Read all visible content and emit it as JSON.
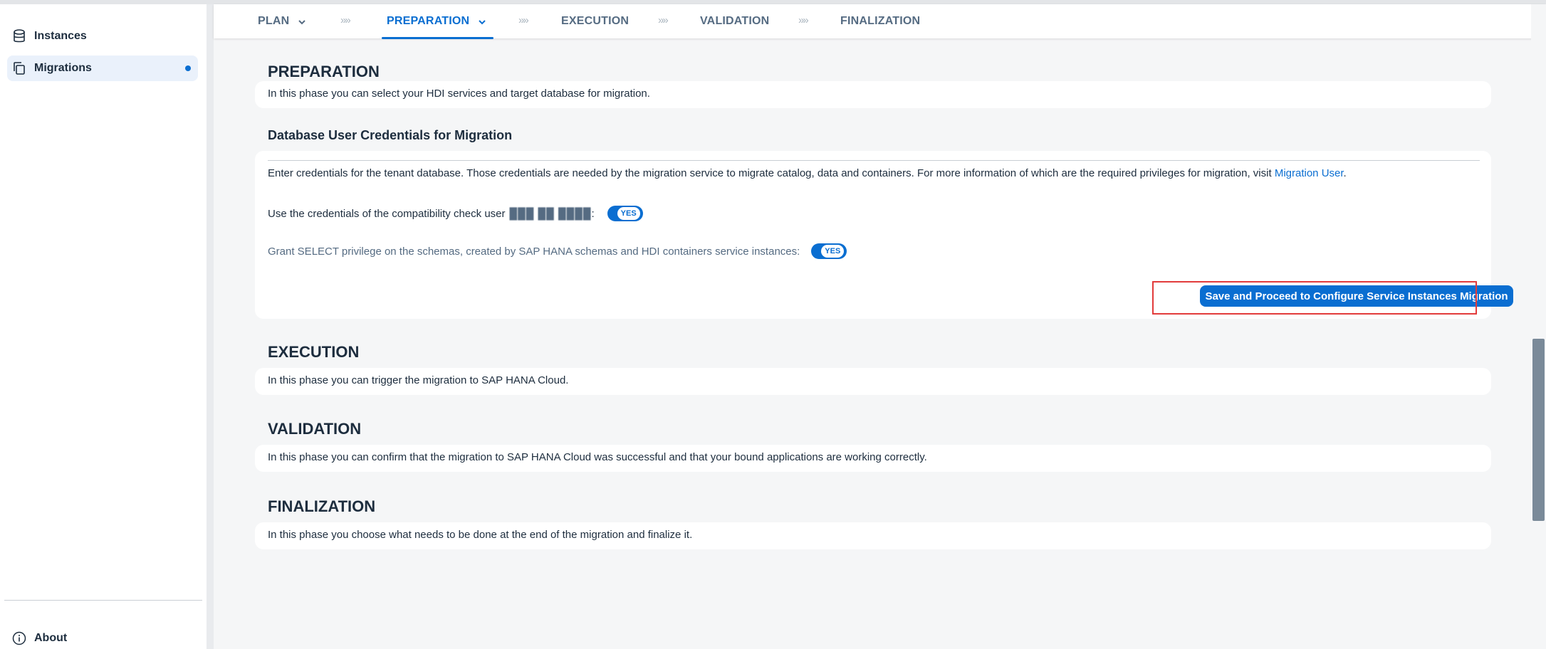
{
  "sidebar": {
    "items": [
      {
        "label": "Instances",
        "icon": "database-icon"
      },
      {
        "label": "Migrations",
        "icon": "copy-icon",
        "selected": true
      }
    ],
    "about": {
      "label": "About",
      "icon": "info-icon"
    }
  },
  "wizard": {
    "steps": [
      {
        "label": "PLAN"
      },
      {
        "label": "PREPARATION",
        "active": true
      },
      {
        "label": "EXECUTION"
      },
      {
        "label": "VALIDATION"
      },
      {
        "label": "FINALIZATION"
      }
    ],
    "separator": "»»"
  },
  "preparation": {
    "title": "PREPARATION",
    "description": "In this phase you can select your HDI services and target database for migration.",
    "credentials_title": "Database User Credentials for Migration",
    "credentials_text": "Enter credentials for the tenant database. Those credentials are needed by the migration service to migrate catalog, data and containers. For more information of which are the required privileges for migration, visit",
    "credentials_link": "Migration User",
    "use_credentials_label": "Use the credentials of the compatibility check user",
    "masked_user": "███ ██ ████",
    "use_credentials_value": "YES",
    "grant_label": "Grant SELECT privilege on the schemas, created by SAP HANA schemas and HDI containers service instances:",
    "grant_value": "YES",
    "save_button": "Save and Proceed to Configure Service Instances Migration"
  },
  "execution": {
    "title": "EXECUTION",
    "description": "In this phase you can trigger the migration to SAP HANA Cloud."
  },
  "validation": {
    "title": "VALIDATION",
    "description": "In this phase you can confirm that the migration to SAP HANA Cloud was successful and that your bound applications are working correctly."
  },
  "finalization": {
    "title": "FINALIZATION",
    "description": "In this phase you choose what needs to be done at the end of the migration and finalize it."
  },
  "colors": {
    "accent": "#0a6ed1",
    "highlight": "#e23b3b"
  }
}
